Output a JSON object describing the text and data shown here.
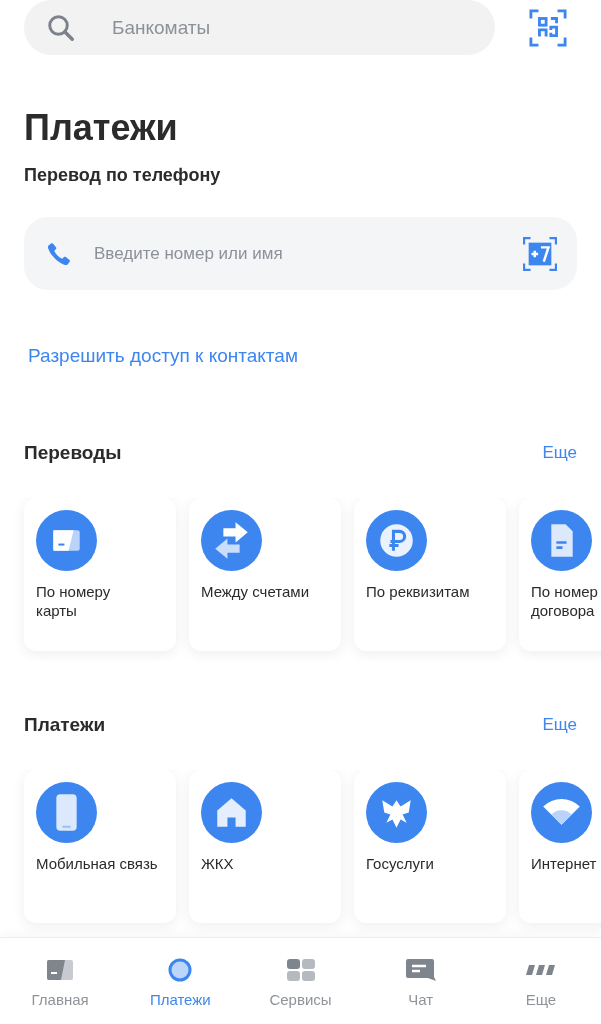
{
  "search": {
    "placeholder": "Банкоматы"
  },
  "page_title": "Платежи",
  "phone_transfer": {
    "title": "Перевод по телефону",
    "field": {
      "placeholder": "Введите номер или имя"
    },
    "contacts_link": "Разрешить доступ к контактам"
  },
  "sections": [
    {
      "title": "Переводы",
      "more": "Еще",
      "items": [
        {
          "label": "По номеру\nкарты",
          "kind": "card"
        },
        {
          "label": "Между счетами",
          "kind": "arrows"
        },
        {
          "label": "По реквизитам",
          "kind": "ruble"
        },
        {
          "label": "По номер\nдоговора",
          "kind": "document"
        }
      ]
    },
    {
      "title": "Платежи",
      "more": "Еще",
      "items": [
        {
          "label": "Мобильная связь",
          "kind": "phone"
        },
        {
          "label": "ЖКХ",
          "kind": "house"
        },
        {
          "label": "Госуслуги",
          "kind": "emblem"
        },
        {
          "label": "Интернет",
          "kind": "wifi"
        }
      ]
    }
  ],
  "bottom_nav": [
    {
      "label": "Главная",
      "kind": "home",
      "selected": false
    },
    {
      "label": "Платежи",
      "kind": "payments",
      "selected": true
    },
    {
      "label": "Сервисы",
      "kind": "services",
      "selected": false
    },
    {
      "label": "Чат",
      "kind": "chat",
      "selected": false
    },
    {
      "label": "Еще",
      "kind": "more",
      "selected": false
    }
  ]
}
